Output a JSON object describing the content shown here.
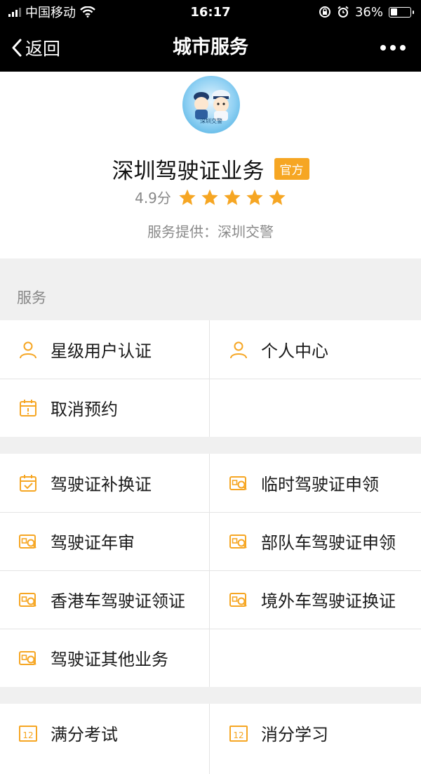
{
  "status_bar": {
    "carrier": "中国移动",
    "time": "16:17",
    "battery": "36%",
    "battery_level": 0.36
  },
  "nav": {
    "back_label": "返回",
    "title": "城市服务"
  },
  "header": {
    "logo_text": "深圳交警",
    "title": "深圳驾驶证业务",
    "badge": "官方",
    "rating": "4.9分",
    "stars": 5,
    "provider": "服务提供：深圳交警"
  },
  "section_label": "服务",
  "group1": [
    {
      "label": "星级用户认证",
      "icon": "person-icon"
    },
    {
      "label": "个人中心",
      "icon": "person-icon"
    },
    {
      "label": "取消预约",
      "icon": "calendar-alert-icon"
    }
  ],
  "group2": [
    {
      "label": "驾驶证补换证",
      "icon": "calendar-check-icon"
    },
    {
      "label": "临时驾驶证申领",
      "icon": "license-search-icon"
    },
    {
      "label": "驾驶证年审",
      "icon": "license-search-icon"
    },
    {
      "label": "部队车驾驶证申领",
      "icon": "license-search-icon"
    },
    {
      "label": "香港车驾驶证领证",
      "icon": "license-search-icon"
    },
    {
      "label": "境外车驾驶证换证",
      "icon": "license-search-icon"
    },
    {
      "label": "驾驶证其他业务",
      "icon": "license-search-icon"
    }
  ],
  "group3": [
    {
      "label": "满分考试",
      "icon": "calendar-12-icon"
    },
    {
      "label": "消分学习",
      "icon": "calendar-12-icon"
    }
  ],
  "colors": {
    "accent": "#f6a623",
    "nav_bg": "#000000",
    "page_bg": "#f0f0f0"
  }
}
